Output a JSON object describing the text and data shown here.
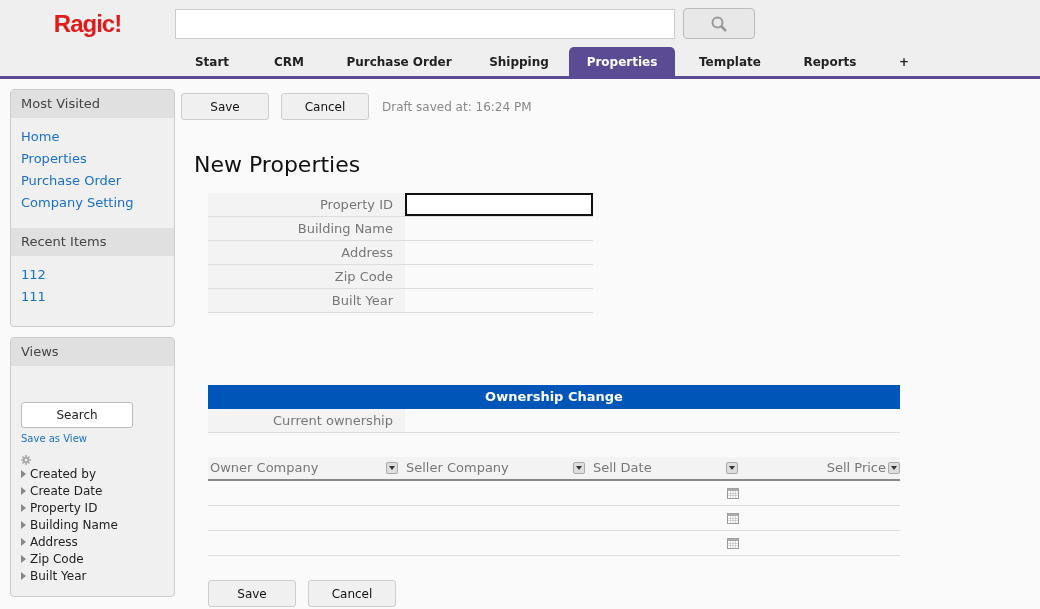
{
  "logo": "Ragic!",
  "tabs": [
    {
      "label": "Start",
      "selected": false
    },
    {
      "label": "CRM",
      "selected": false
    },
    {
      "label": "Purchase Order",
      "selected": false
    },
    {
      "label": "Shipping",
      "selected": false
    },
    {
      "label": "Properties",
      "selected": true
    },
    {
      "label": "Template",
      "selected": false
    },
    {
      "label": "Reports",
      "selected": false
    },
    {
      "label": "+",
      "selected": false
    }
  ],
  "sidebar": {
    "most_visited": {
      "title": "Most Visited",
      "items": [
        "Home",
        "Properties",
        "Purchase Order",
        "Company Setting"
      ]
    },
    "recent_items": {
      "title": "Recent Items",
      "items": [
        "112",
        "111"
      ]
    },
    "views": {
      "title": "Views",
      "search_button": "Search",
      "save_link": "Save as View",
      "fields": [
        "Created by",
        "Create Date",
        "Property ID",
        "Building Name",
        "Address",
        "Zip Code",
        "Built Year"
      ]
    }
  },
  "toolbar": {
    "buttons": [
      "Save",
      "Cancel"
    ],
    "draft_status": "Draft saved at: 16:24 PM"
  },
  "page_title": "New Properties",
  "fields": [
    {
      "label": "Property ID",
      "focused": true
    },
    {
      "label": "Building Name",
      "focused": false
    },
    {
      "label": "Address",
      "focused": false
    },
    {
      "label": "Zip Code",
      "focused": false
    },
    {
      "label": "Built Year",
      "focused": false
    }
  ],
  "subtable": {
    "title": "Ownership Change",
    "current_label": "Current ownership",
    "columns": [
      {
        "label": "Owner Company",
        "kind": "text"
      },
      {
        "label": "Seller Company",
        "kind": "text"
      },
      {
        "label": "Sell Date",
        "kind": "date"
      },
      {
        "label": "Sell Price",
        "kind": "number"
      }
    ],
    "rows": [
      {
        "kind": "blank"
      },
      {
        "kind": "blank"
      },
      {
        "kind": "blank"
      }
    ]
  },
  "bottom_buttons": [
    "Save",
    "Cancel"
  ]
}
